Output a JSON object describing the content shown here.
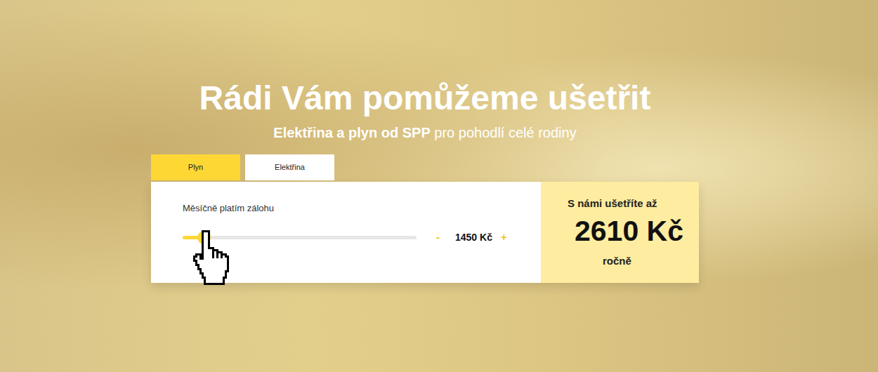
{
  "hero": {
    "title": "Rádi Vám pomůžeme ušetřit",
    "subtitle_bold": "Elektřina a plyn od SPP",
    "subtitle_rest": "pro pohodlí celé rodiny"
  },
  "tabs": [
    {
      "label": "Plyn",
      "selected": true
    },
    {
      "label": "Elektřina",
      "selected": false
    }
  ],
  "slider": {
    "label": "Měsíčně platím zálohu",
    "level": 0.09,
    "minus": "-",
    "value": "1450 Kč",
    "plus": "+"
  },
  "savings": {
    "lead": "S námi ušetříte až",
    "amount": "2610 Kč",
    "period": "ročně"
  }
}
